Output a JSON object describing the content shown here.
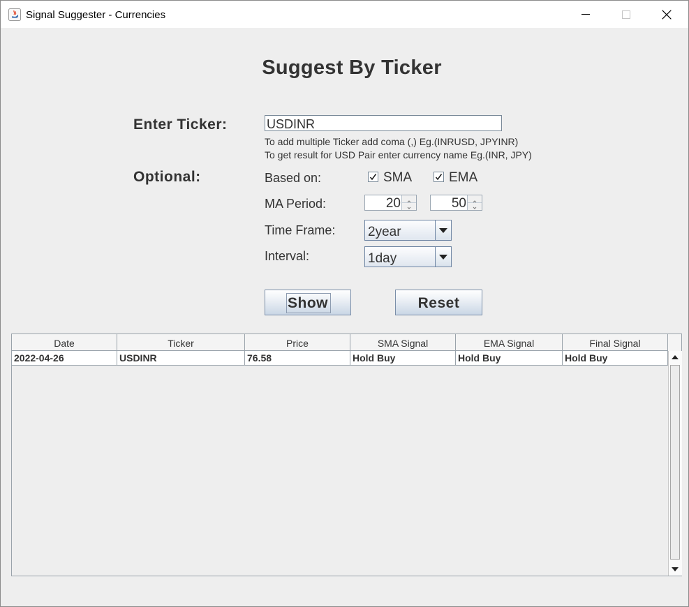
{
  "window": {
    "title": "Signal Suggester - Currencies"
  },
  "heading": "Suggest By Ticker",
  "form": {
    "ticker_label": "Enter Ticker:",
    "ticker_value": "USDINR",
    "hint1": "To add multiple Ticker add coma (,) Eg.(INRUSD, JPYINR)",
    "hint2": "To get result for USD Pair enter currency name Eg.(INR, JPY)",
    "optional_label": "Optional:",
    "based_on_label": "Based on:",
    "sma_label": "SMA",
    "sma_checked": true,
    "ema_label": "EMA",
    "ema_checked": true,
    "ma_period_label": "MA Period:",
    "ma_period_1": "20",
    "ma_period_2": "50",
    "time_frame_label": "Time Frame:",
    "time_frame_value": "2year",
    "interval_label": "Interval:",
    "interval_value": "1day"
  },
  "buttons": {
    "show": "Show",
    "reset": "Reset"
  },
  "table": {
    "columns": [
      "Date",
      "Ticker",
      "Price",
      "SMA Signal",
      "EMA Signal",
      "Final Signal"
    ],
    "rows": [
      [
        "2022-04-26",
        "USDINR",
        "76.58",
        "Hold Buy",
        "Hold Buy",
        "Hold Buy"
      ]
    ]
  },
  "colors": {
    "background": "#eeeeee",
    "text": "#333333",
    "button_gradient_end": "#c9d6e5"
  }
}
